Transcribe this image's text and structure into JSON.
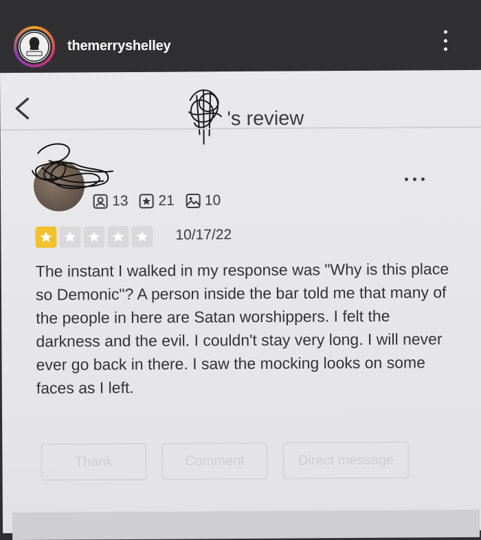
{
  "instagram": {
    "username": "themerryshelley",
    "avatar_icon": "merry-shelley-logo"
  },
  "review_page": {
    "title_suffix": "'s review",
    "back_icon": "chevron-left-icon",
    "reviewer": {
      "friends_count": "13",
      "reviews_count": "21",
      "photos_count": "10"
    },
    "rating": {
      "stars": 1,
      "max_stars": 5,
      "filled_color": "#f2c12e",
      "empty_color": "#d9d9db"
    },
    "date": "10/17/22",
    "text": "The instant I walked in my response was \"Why is this place so Demonic\"?  A person inside the bar told me that many of the people in here are Satan worshippers.  I felt the darkness and the evil.  I couldn't stay very long.  I will never ever go back in there.  I saw the mocking looks on some faces as I left.",
    "actions": {
      "thank_label": "Thank",
      "comment_label": "Comment",
      "direct_message_label": "Direct message"
    }
  }
}
